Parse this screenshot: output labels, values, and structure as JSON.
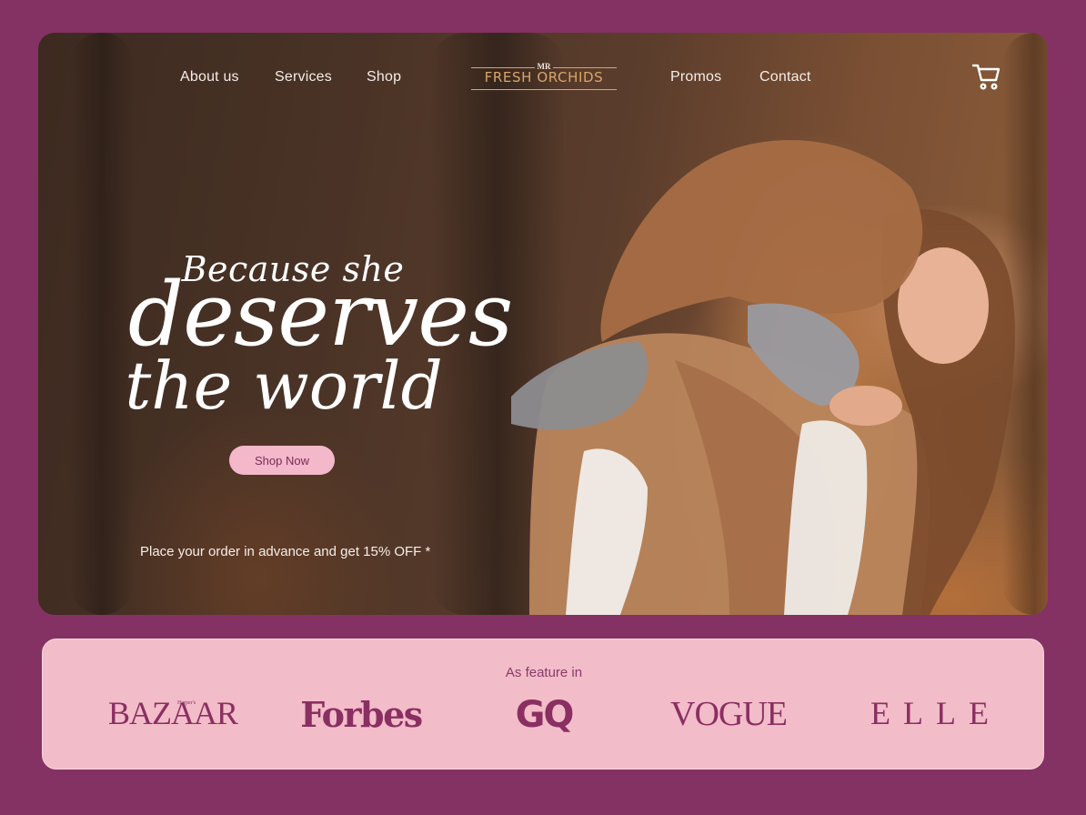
{
  "nav": {
    "left_links": [
      "About us",
      "Services",
      "Shop"
    ],
    "right_links": [
      "Promos",
      "Contact"
    ],
    "logo": {
      "small": "MR",
      "name": "FRESH ORCHIDS"
    },
    "cart_icon": "cart-icon"
  },
  "hero": {
    "line1": "Because she",
    "line2": "deserves",
    "line3": "the world",
    "cta_label": "Shop Now",
    "promo_text": "Place your order in advance and get 15% OFF *"
  },
  "featured": {
    "title": "As feature in",
    "brands": [
      "BAZAAR",
      "Forbes",
      "GQ",
      "VOGUE",
      "ELLE"
    ],
    "bazaar_tag": "Harper's"
  },
  "colors": {
    "background": "#843263",
    "accent_pink": "#f3b8c9",
    "brand_plum": "#8a2f62",
    "logo_gold": "#d9a56a"
  }
}
